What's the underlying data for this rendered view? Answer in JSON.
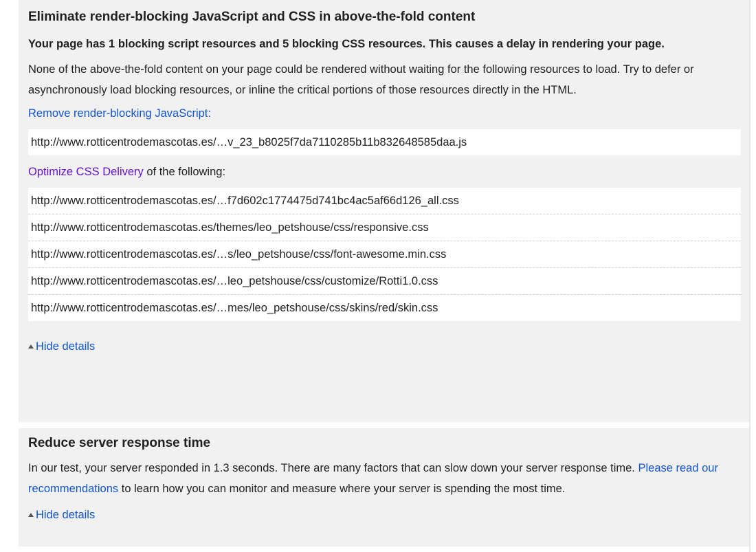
{
  "rules": [
    {
      "title": "Eliminate render-blocking JavaScript and CSS in above-the-fold content",
      "summary": "Your page has 1 blocking script resources and 5 blocking CSS resources. This causes a delay in rendering your page.",
      "description": "None of the above-the-fold content on your page could be rendered without waiting for the following resources to load. Try to defer or asynchronously load blocking resources, or inline the critical portions of those resources directly in the HTML.",
      "js_fix": {
        "link": "Remove render-blocking JavaScript",
        "suffix": ":"
      },
      "js_urls": [
        "http://www.rotticentrodemascotas.es/…v_23_b8025f7da7110285b11b832648585daa.js"
      ],
      "css_fix": {
        "link": "Optimize CSS Delivery",
        "suffix": " of the following:"
      },
      "css_urls": [
        "http://www.rotticentrodemascotas.es/…f7d602c1774475d741bc4ac5af66d126_all.css",
        "http://www.rotticentrodemascotas.es/themes/leo_petshouse/css/responsive.css",
        "http://www.rotticentrodemascotas.es/…s/leo_petshouse/css/font-awesome.min.css",
        "http://www.rotticentrodemascotas.es/…leo_petshouse/css/customize/Rotti1.0.css",
        "http://www.rotticentrodemascotas.es/…mes/leo_petshouse/css/skins/red/skin.css"
      ],
      "toggle_label": "Hide details",
      "toggle_icon": "caret-up-icon"
    },
    {
      "title": "Reduce server response time",
      "text_before": "In our test, your server responded in 1.3 seconds. There are many factors that can slow down your server response time. ",
      "link": "Please read our recommendations",
      "text_after": " to learn how you can monitor and measure where your server is spending the most time.",
      "toggle_label": "Hide details",
      "toggle_icon": "caret-up-icon"
    }
  ],
  "colors": {
    "panel_bg": "#f1f1f1",
    "link": "#1155cc",
    "visited_link": "#6611cc",
    "text": "#212121"
  }
}
